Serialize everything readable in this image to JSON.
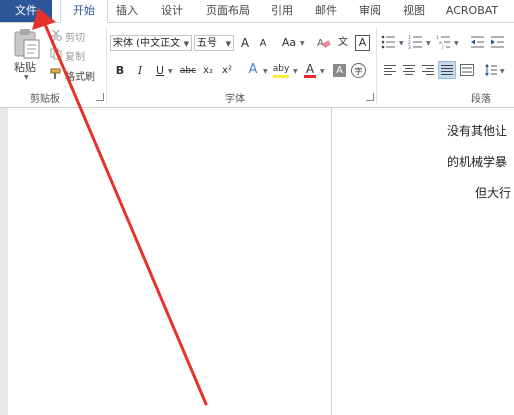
{
  "tabs": [
    {
      "label": "文件"
    },
    {
      "label": "开始"
    },
    {
      "label": "插入"
    },
    {
      "label": "设计"
    },
    {
      "label": "页面布局"
    },
    {
      "label": "引用"
    },
    {
      "label": "邮件"
    },
    {
      "label": "审阅"
    },
    {
      "label": "视图"
    },
    {
      "label": "ACROBAT"
    }
  ],
  "clipboard": {
    "paste_label": "粘贴",
    "cut_label": "剪切",
    "copy_label": "复制",
    "format_painter_label": "格式刷",
    "group_label": "剪贴板"
  },
  "font": {
    "font_name": "宋体 (中文正文",
    "font_size": "五号",
    "grow_label": "A",
    "shrink_label": "A",
    "case_label": "Aa",
    "phonetic_label": "文",
    "border_label": "A",
    "bold_label": "B",
    "italic_label": "I",
    "underline_label": "U",
    "strike_label": "abc",
    "subscript_label": "x₂",
    "superscript_label": "x²",
    "effects_label": "A",
    "highlight_label": "aby",
    "color_label": "A",
    "shading_label": "A",
    "enclose_label": "字",
    "group_label": "字体"
  },
  "paragraph": {
    "group_label": "段落"
  },
  "document": {
    "lines": [
      "没有其他让",
      "的机械学暴",
      "但大行"
    ]
  },
  "colors": {
    "file_tab": "#2b579a",
    "accent": "#2b579a",
    "arrow": "#e5322d",
    "font_color_bar": "#e52b2b",
    "highlight_bar": "#f7ef3a"
  }
}
